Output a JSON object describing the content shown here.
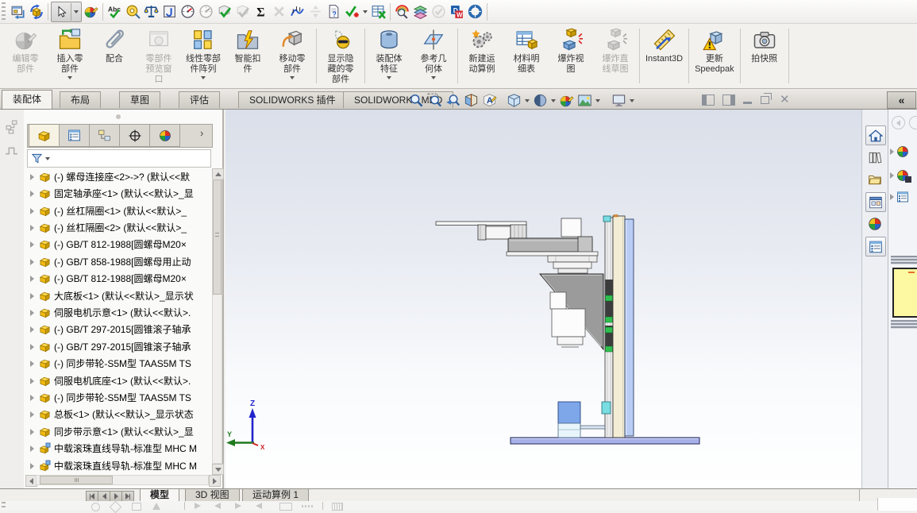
{
  "window": {
    "collapse_glyph": "«",
    "close_glyph": "✕"
  },
  "toolbar_main": {
    "icons": [
      "window-layout",
      "rebuild",
      "select-cursor",
      "edit-appearance",
      "spell-check",
      "measure",
      "mass-properties",
      "section-properties",
      "performance-evaluation",
      "sensors",
      "check-document",
      "compare-documents",
      "equations",
      "interference-detection",
      "curvature",
      "compress",
      "document-properties",
      "design-checker",
      "design-table",
      "assembly-visualization",
      "costing-layers",
      "analysis-check",
      "driveworksxpress",
      "routing"
    ]
  },
  "ribbon": {
    "buttons": [
      {
        "label": "编辑零\n部件",
        "disabled": true
      },
      {
        "label": "插入零\n部件",
        "caret": true
      },
      {
        "label": "配合"
      },
      {
        "label": "零部件\n预览窗\n口",
        "disabled": true
      },
      {
        "label": "线性零部\n件阵列",
        "caret": true
      },
      {
        "label": "智能扣\n件"
      },
      {
        "label": "移动零\n部件",
        "caret": true
      },
      {
        "label": "显示隐\n藏的零\n部件"
      },
      {
        "label": "装配体\n特征",
        "caret": true
      },
      {
        "label": "参考几\n何体",
        "caret": true
      },
      {
        "label": "新建运\n动算例"
      },
      {
        "label": "材料明\n细表"
      },
      {
        "label": "爆炸视\n图"
      },
      {
        "label": "爆炸直\n线草图",
        "disabled": true
      },
      {
        "label": "Instant3D"
      },
      {
        "label": "更新\nSpeedpak"
      },
      {
        "label": "拍快照"
      }
    ]
  },
  "command_tabs": {
    "tabs": [
      "装配体",
      "布局",
      "草图",
      "评估",
      "SOLIDWORKS 插件",
      "SOLIDWORKS MBD"
    ],
    "active": "装配体"
  },
  "headsup": {
    "icons": [
      "zoom-fit",
      "zoom-area",
      "previous-view",
      "section-view",
      "annotation-view",
      "view-orientation",
      "display-style",
      "edit-appearance",
      "apply-scene",
      "view-settings"
    ]
  },
  "window_controls": [
    "dock-left",
    "dock-right",
    "minimize",
    "restore",
    "close"
  ],
  "feature_panel": {
    "tabs": [
      "featuremanager",
      "propertymanager",
      "configurationmanager",
      "dimxpertmanager",
      "displaymanager"
    ],
    "items": [
      {
        "label": "(-) 螺母连接座<2>->? (默认<<默",
        "icon": "part"
      },
      {
        "label": "固定轴承座<1> (默认<<默认>_显",
        "icon": "part"
      },
      {
        "label": "(-) 丝杠隔圈<1> (默认<<默认>_",
        "icon": "part"
      },
      {
        "label": "(-) 丝杠隔圈<2> (默认<<默认>_",
        "icon": "part"
      },
      {
        "label": "(-) GB/T 812-1988[圆螺母M20×",
        "icon": "part"
      },
      {
        "label": "(-) GB/T 858-1988[圆螺母用止动",
        "icon": "part"
      },
      {
        "label": "(-) GB/T 812-1988[圆螺母M20×",
        "icon": "part"
      },
      {
        "label": "大底板<1> (默认<<默认>_显示状",
        "icon": "part"
      },
      {
        "label": "伺服电机示意<1> (默认<<默认>.",
        "icon": "part"
      },
      {
        "label": "(-) GB/T 297-2015[圆锥滚子轴承",
        "icon": "part"
      },
      {
        "label": "(-) GB/T 297-2015[圆锥滚子轴承",
        "icon": "part"
      },
      {
        "label": "(-) 同步带轮-S5M型 TAAS5M TS",
        "icon": "part"
      },
      {
        "label": "伺服电机底座<1> (默认<<默认>.",
        "icon": "part"
      },
      {
        "label": "(-) 同步带轮-S5M型 TAAS5M TS",
        "icon": "part"
      },
      {
        "label": "总板<1> (默认<<默认>_显示状态",
        "icon": "part"
      },
      {
        "label": "同步带示意<1> (默认<<默认>_显",
        "icon": "part"
      },
      {
        "label": "中载滚珠直线导轨-标准型 MHC M",
        "icon": "part-ext"
      },
      {
        "label": "中载滚珠直线导轨-标准型 MHC M",
        "icon": "part-ext"
      }
    ]
  },
  "taskpane": {
    "tabs": [
      "solidworks-resources",
      "design-library",
      "file-explorer",
      "view-palette",
      "appearances-scenes",
      "custom-properties"
    ]
  },
  "viewport": {
    "triad": {
      "z": "Z",
      "y": "Y",
      "x": "X"
    }
  },
  "bottom_tabs": {
    "tabs": [
      {
        "label": "模型"
      },
      {
        "label": "3D 视图"
      },
      {
        "label": "运动算例 1"
      }
    ],
    "active": "模型"
  },
  "colors": {
    "part_yellow": "#f2c021",
    "column_cream": "#f3edd5",
    "column_blue": "#b9cdf4",
    "base_purple": "#a8b0e9",
    "bracket_gray": "#9b9b9b",
    "guide_green": "#2fbf4f",
    "viewport_top": "#dadfe9"
  }
}
